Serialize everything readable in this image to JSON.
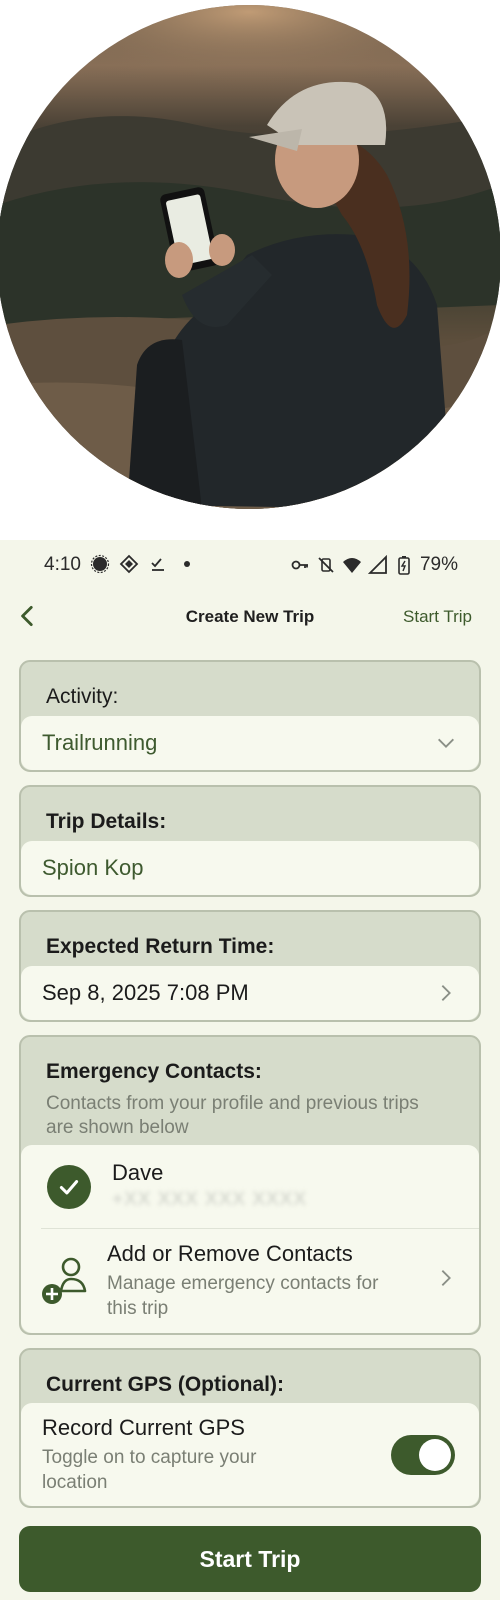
{
  "status_bar": {
    "time": "4:10",
    "battery": "79%",
    "left_icons": [
      "signal-app-icon",
      "diamond-icon",
      "checklist-icon",
      "dot-icon"
    ],
    "right_icons": [
      "key-icon",
      "vibrate-off-icon",
      "wifi-icon",
      "cell-signal-icon",
      "battery-charging-icon"
    ]
  },
  "app_bar": {
    "back_icon": "chevron-left-icon",
    "title": "Create New Trip",
    "action": "Start Trip"
  },
  "activity": {
    "label": "Activity:",
    "value": "Trailrunning"
  },
  "trip_details": {
    "label": "Trip Details:",
    "value": "Spion Kop"
  },
  "return_time": {
    "label": "Expected Return Time:",
    "value": "Sep 8, 2025 7:08 PM"
  },
  "emergency_contacts": {
    "label": "Emergency Contacts:",
    "subtitle": "Contacts from your profile and previous trips are shown below",
    "contacts": [
      {
        "name": "Dave",
        "phone": "+XX XXX XXX XXXX",
        "selected": true
      }
    ],
    "manage_title": "Add or Remove Contacts",
    "manage_subtitle": "Manage emergency contacts for this trip"
  },
  "gps": {
    "label": "Current GPS (Optional):",
    "title": "Record Current GPS",
    "subtitle": "Toggle on to capture your location",
    "enabled": true
  },
  "primary_button": "Start Trip",
  "colors": {
    "primary": "#3d5a2c",
    "screen_bg": "#f4f6ea",
    "card_bg": "#d6dccb",
    "field_bg": "#f7f9ee"
  }
}
